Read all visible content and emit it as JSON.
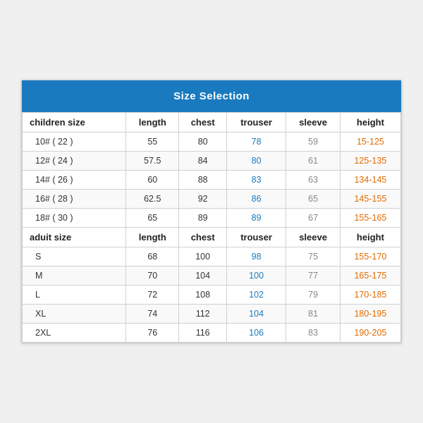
{
  "title": "Size Selection",
  "columns": [
    "children size",
    "length",
    "chest",
    "trouser",
    "sleeve",
    "height"
  ],
  "adult_columns": [
    "aduit size",
    "length",
    "chest",
    "trouser",
    "sleeve",
    "height"
  ],
  "children_rows": [
    [
      "10# ( 22 )",
      "55",
      "80",
      "78",
      "59",
      "15-125"
    ],
    [
      "12# ( 24 )",
      "57.5",
      "84",
      "80",
      "61",
      "125-135"
    ],
    [
      "14# ( 26 )",
      "60",
      "88",
      "83",
      "63",
      "134-145"
    ],
    [
      "16# ( 28 )",
      "62.5",
      "92",
      "86",
      "65",
      "145-155"
    ],
    [
      "18# ( 30 )",
      "65",
      "89",
      "89",
      "67",
      "155-165"
    ]
  ],
  "adult_rows": [
    [
      "S",
      "68",
      "100",
      "98",
      "75",
      "155-170"
    ],
    [
      "M",
      "70",
      "104",
      "100",
      "77",
      "165-175"
    ],
    [
      "L",
      "72",
      "108",
      "102",
      "79",
      "170-185"
    ],
    [
      "XL",
      "74",
      "112",
      "104",
      "81",
      "180-195"
    ],
    [
      "2XL",
      "76",
      "116",
      "106",
      "83",
      "190-205"
    ]
  ]
}
